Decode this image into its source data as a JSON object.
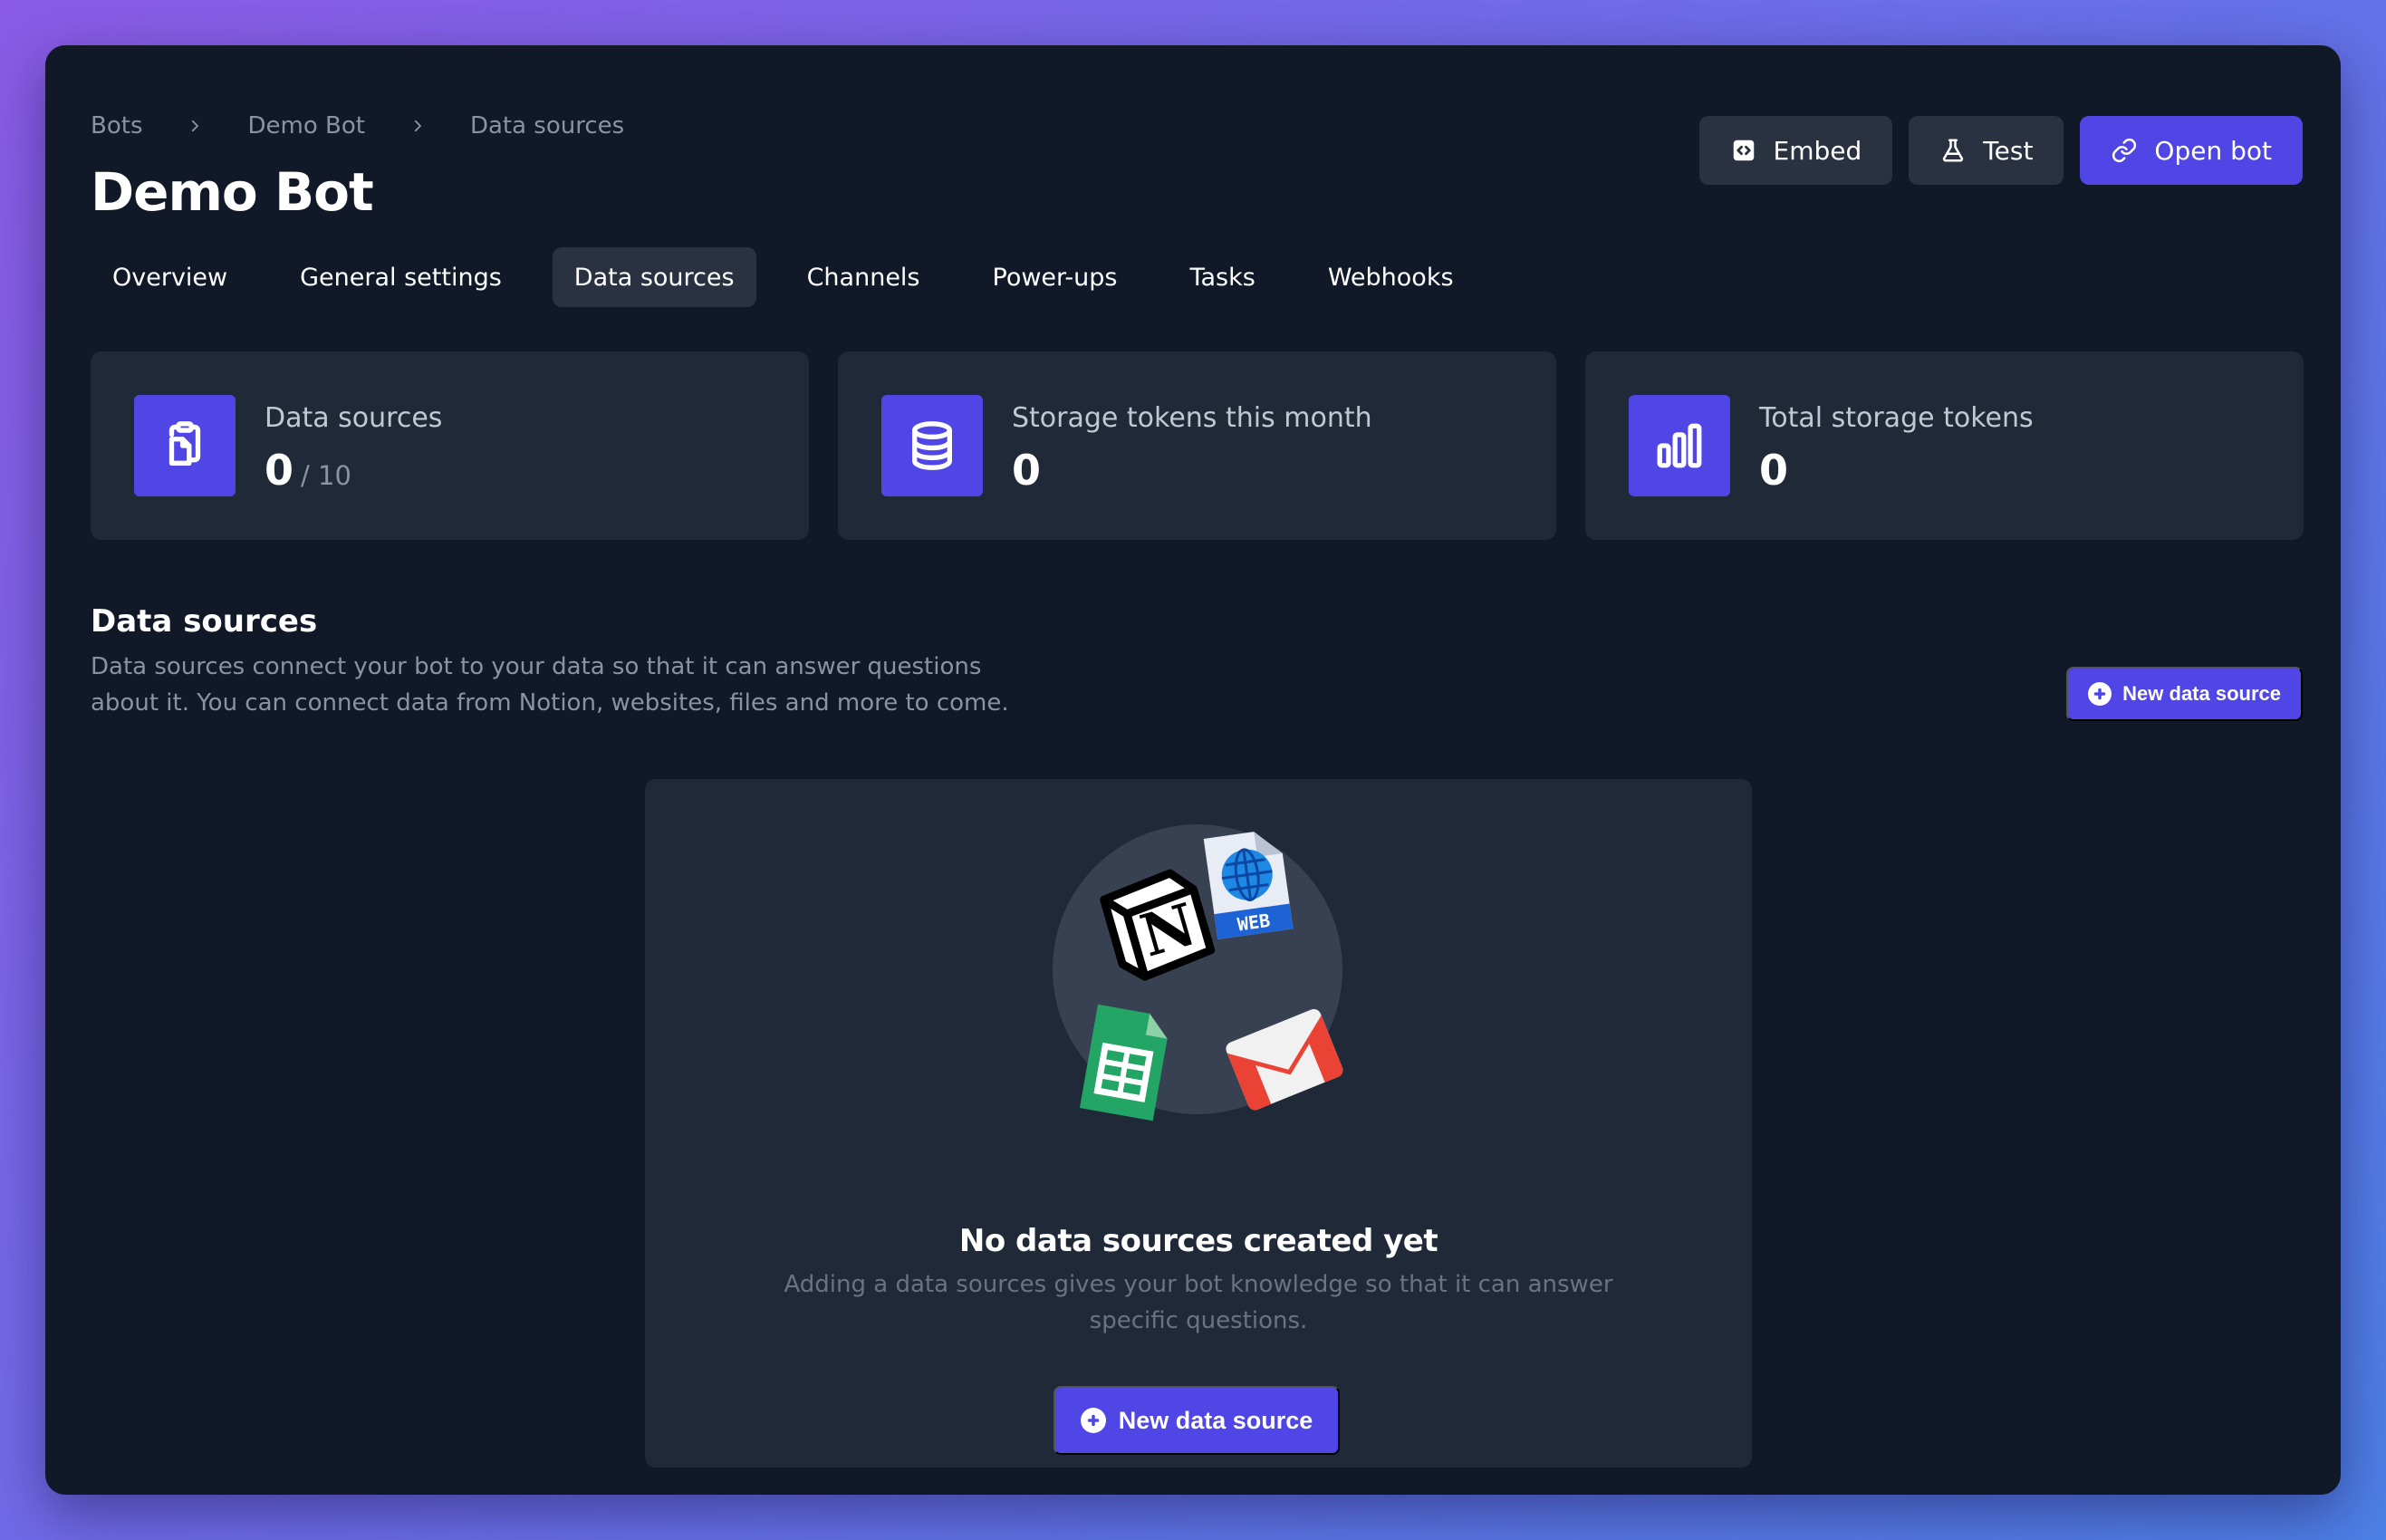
{
  "breadcrumb": {
    "items": [
      "Bots",
      "Demo Bot",
      "Data sources"
    ]
  },
  "page": {
    "title": "Demo Bot"
  },
  "header_actions": {
    "embed": "Embed",
    "test": "Test",
    "open_bot": "Open bot"
  },
  "tabs": [
    {
      "label": "Overview",
      "active": false
    },
    {
      "label": "General settings",
      "active": false
    },
    {
      "label": "Data sources",
      "active": true
    },
    {
      "label": "Channels",
      "active": false
    },
    {
      "label": "Power-ups",
      "active": false
    },
    {
      "label": "Tasks",
      "active": false
    },
    {
      "label": "Webhooks",
      "active": false
    }
  ],
  "stats": [
    {
      "label": "Data sources",
      "value": "0",
      "suffix": "/ 10",
      "icon": "clipboard-icon"
    },
    {
      "label": "Storage tokens this month",
      "value": "0",
      "suffix": "",
      "icon": "database-icon"
    },
    {
      "label": "Total storage tokens",
      "value": "0",
      "suffix": "",
      "icon": "bar-chart-icon"
    }
  ],
  "section": {
    "title": "Data sources",
    "description": "Data sources connect your bot to your data so that it can answer questions about it. You can connect data from Notion, websites, files and more to come.",
    "new_button": "New data source"
  },
  "empty_state": {
    "title": "No data sources created yet",
    "description": "Adding a data sources gives your bot knowledge so that it can answer specific questions.",
    "button": "New data source",
    "web_badge": "WEB",
    "notion_letter": "N"
  },
  "colors": {
    "background_from": "#8b5be6",
    "background_to": "#4d7fe6",
    "window": "#111827",
    "card": "#1f2937",
    "accent": "#4f46e5",
    "muted_text": "#8a93a3"
  }
}
